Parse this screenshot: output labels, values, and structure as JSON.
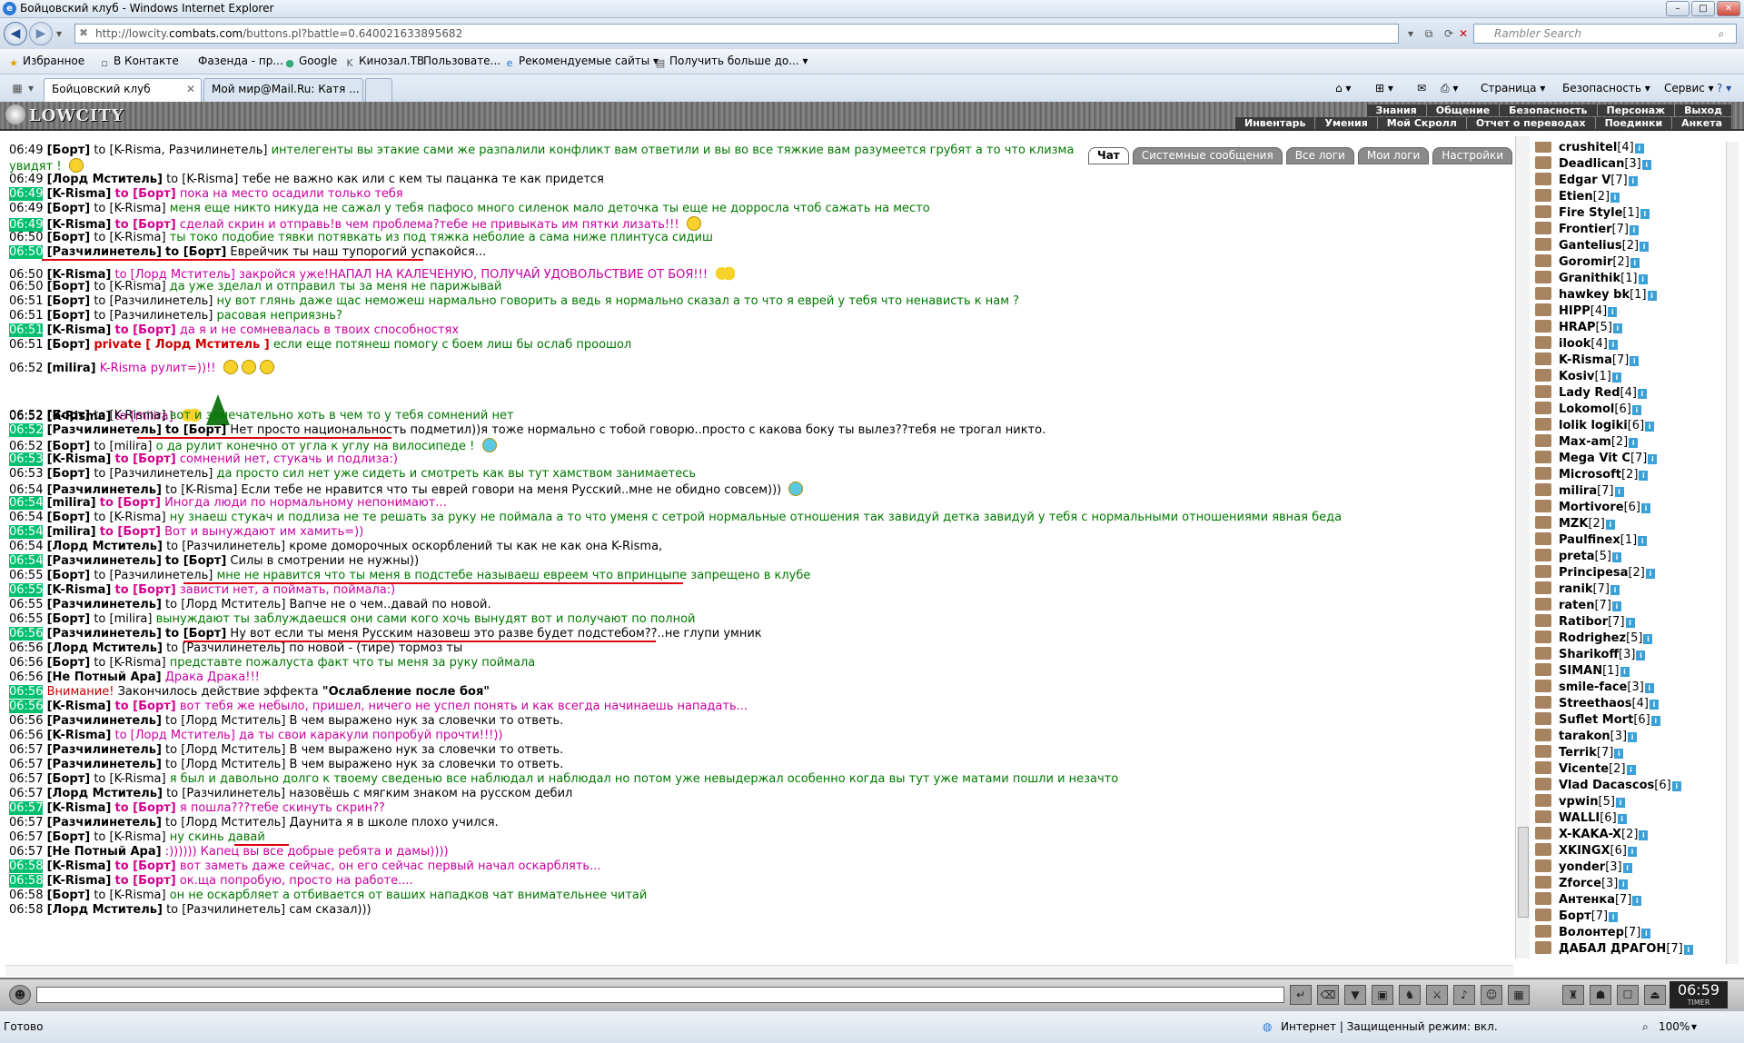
{
  "window": {
    "title": "Бойцовский клуб - Windows Internet Explorer",
    "min": "–",
    "max": "□",
    "close": "✕"
  },
  "address": {
    "prefix": "http://lowcity.",
    "domain": "combats.com",
    "suffix": "/buttons.pl?battle=0.640021633895682",
    "search_placeholder": "Rambler Search"
  },
  "favorites": {
    "label": "Избранное",
    "items": [
      "В Контакте",
      "Фазенда - пр...",
      "Google",
      "Кинозал.ТВ",
      "Пользовате...",
      "Рекомендуемые сайты",
      "Получить больше до..."
    ]
  },
  "tabs": [
    {
      "label": "Бойцовский клуб"
    },
    {
      "label": "Мой мир@Mail.Ru: Катя ..."
    }
  ],
  "commands": {
    "page": "Страница",
    "safety": "Безопасность",
    "service": "Сервис"
  },
  "game": {
    "logo": "LOWCITY",
    "menu1": [
      "Знания",
      "Общение",
      "Безопасность",
      "Персонаж",
      "Выход"
    ],
    "menu2": [
      "Инвентарь",
      "Умения",
      "Мой Скролл",
      "Отчет о переводах",
      "Поединки",
      "Анкета"
    ]
  },
  "chat_tabs": [
    "Чат",
    "Системные сообщения",
    "Все логи",
    "Мои логи",
    "Настройки"
  ],
  "chat": [
    {
      "t": "06:49",
      "hl": false,
      "nick": "[Борт]",
      "to": "to [K-Risma, Разчилинетель]",
      "tp": "n",
      "msg": "интелегенты вы этакие сами же разпалили конфликт вам ответили и вы во все тяжкие вам разумеется грубят а то что клизма",
      "mc": "g"
    },
    {
      "t": "",
      "hl": false,
      "nick": "",
      "to": "",
      "tp": "n",
      "msg": "увидят !",
      "mc": "g"
    },
    {
      "t": "06:49",
      "hl": false,
      "nick": "[Лорд Мститель]",
      "to": "to [K-Risma]",
      "tp": "n",
      "msg": "тебе не важно как или с кем ты пацанка те как придется",
      "mc": "k"
    },
    {
      "t": "06:49",
      "hl": true,
      "nick": "[K-Risma]",
      "to": "to [Борт]",
      "tp": "b",
      "msg": "пока на место осадили только тебя",
      "mc": "p"
    },
    {
      "t": "06:49",
      "hl": false,
      "nick": "[Борт]",
      "to": "to [K-Risma]",
      "tp": "n",
      "msg": "меня еще никто никуда не сажал у тебя пафосо много силенок мало деточка ты еще не дорросла чтоб сажать на место",
      "mc": "g"
    },
    {
      "t": "06:49",
      "hl": true,
      "nick": "[K-Risma]",
      "to": "to [Борт]",
      "tp": "b",
      "msg": "сделай скрин и отправь!в чем проблема?тебе не привыкать им пятки лизать!!!",
      "mc": "p"
    },
    {
      "t": "06:50",
      "hl": false,
      "nick": "[Борт]",
      "to": "to [K-Risma]",
      "tp": "n",
      "msg": "ты токо подобие тявки потявкать из под тяжка неболие а сама ниже плинтуса сидиш",
      "mc": "g"
    },
    {
      "t": "06:50",
      "hl": true,
      "nick": "[Разчилинетель]",
      "to": "to [Борт]",
      "tp": "nb",
      "msg": "Еврейчик ты наш тупорогий успакойся...",
      "mc": "k"
    },
    {
      "t": "06:50",
      "hl": false,
      "nick": "[K-Risma]",
      "to": "to [Лорд Мститель]",
      "tp": "p",
      "msg": "закройся уже!НАПАЛ НА КАЛЕЧЕНУЮ, ПОЛУЧАЙ УДОВОЛЬСТВИЕ ОТ БОЯ!!!",
      "mc": "p"
    },
    {
      "t": "06:50",
      "hl": false,
      "nick": "[Борт]",
      "to": "to [K-Risma]",
      "tp": "n",
      "msg": "да уже зделал и отправил ты за меня не парижывай",
      "mc": "g"
    },
    {
      "t": "06:51",
      "hl": false,
      "nick": "[Борт]",
      "to": "to [Разчилинетель]",
      "tp": "n",
      "msg": "ну вот глянь даже щас неможеш нармально говорить а ведь я нормально сказал а то что я еврей у тебя что ненависть к нам ?",
      "mc": "g"
    },
    {
      "t": "06:51",
      "hl": false,
      "nick": "[Борт]",
      "to": "to [Разчилинетель]",
      "tp": "n",
      "msg": "расовая неприязнь?",
      "mc": "g"
    },
    {
      "t": "06:51",
      "hl": true,
      "nick": "[K-Risma]",
      "to": "to [Борт]",
      "tp": "b",
      "msg": "да я и не сомневалась в твоих способностях",
      "mc": "p"
    },
    {
      "t": "06:51",
      "hl": false,
      "nick": "[Борт]",
      "to": "private [ Лорд Мститель ]",
      "tp": "r",
      "msg": "если еще потянеш помогу с боем лиш бы ослаб проошол",
      "mc": "g"
    },
    {
      "t": "06:52",
      "hl": false,
      "nick": "[milira]",
      "to": "",
      "tp": "n",
      "msg": "K-Risma рулит=))!!",
      "mc": "p"
    },
    {
      "t": "06:52",
      "hl": false,
      "nick": "[K-Risma]",
      "to": "to [milira]",
      "tp": "p",
      "msg": "",
      "mc": "p"
    },
    {
      "t": "06:52",
      "hl": false,
      "nick": "[Борт]",
      "to": "to [K-Risma]",
      "tp": "n",
      "msg": "вот и замечательно хоть в чем то у тебя сомнений нет",
      "mc": "g"
    },
    {
      "t": "06:52",
      "hl": true,
      "nick": "[Разчилинетель]",
      "to": "to [Борт]",
      "tp": "nb",
      "msg": "Нет просто национальность подметил))я тоже нормально с тобой говорю..просто с какова боку ты вылез??тебя не трогал никто.",
      "mc": "k"
    },
    {
      "t": "06:52",
      "hl": false,
      "nick": "[Борт]",
      "to": "to [milira]",
      "tp": "n",
      "msg": "о да рулит конечно от угла к углу на вилосипеде !",
      "mc": "g"
    },
    {
      "t": "06:53",
      "hl": true,
      "nick": "[K-Risma]",
      "to": "to [Борт]",
      "tp": "b",
      "msg": "сомнений нет, стукачь и подлиза:)",
      "mc": "p"
    },
    {
      "t": "06:53",
      "hl": false,
      "nick": "[Борт]",
      "to": "to [Разчилинетель]",
      "tp": "n",
      "msg": "да просто сил нет уже сидеть и смотреть как вы тут хамством занимаетесь",
      "mc": "g"
    },
    {
      "t": "06:54",
      "hl": false,
      "nick": "[Разчилинетель]",
      "to": "to [K-Risma]",
      "tp": "n",
      "msg": "Если тебе не нравится что ты еврей говори на меня Русский..мне не обидно совсем)))",
      "mc": "k"
    },
    {
      "t": "06:54",
      "hl": true,
      "nick": "[milira]",
      "to": "to [Борт]",
      "tp": "b",
      "msg": "Иногда люди по нормальному непонимают...",
      "mc": "p"
    },
    {
      "t": "06:54",
      "hl": false,
      "nick": "[Борт]",
      "to": "to [K-Risma]",
      "tp": "n",
      "msg": "ну знаеш стукач и подлиза не те решать за руку не поймала а то что уменя с сетрой нормальные отношения так завидуй детка завидуй у тебя с нормальными отношениями явная беда",
      "mc": "g"
    },
    {
      "t": "06:54",
      "hl": true,
      "nick": "[milira]",
      "to": "to [Борт]",
      "tp": "b",
      "msg": "Вот и вынуждают им хамить=))",
      "mc": "p"
    },
    {
      "t": "06:54",
      "hl": false,
      "nick": "[Лорд Мститель]",
      "to": "to [Разчилинетель]",
      "tp": "n",
      "msg": "кроме доморочных оскорблений ты как не как она K-Risma,",
      "mc": "k"
    },
    {
      "t": "06:54",
      "hl": true,
      "nick": "[Разчилинетель]",
      "to": "to [Борт]",
      "tp": "nb",
      "msg": "Силы в смотрении не нужны))",
      "mc": "k"
    },
    {
      "t": "06:55",
      "hl": false,
      "nick": "[Борт]",
      "to": "to [Разчилинетель]",
      "tp": "n",
      "msg": "мне не нравится что ты меня в подстебе называеш евреем что впринцыпе запрещено в клубе",
      "mc": "g"
    },
    {
      "t": "06:55",
      "hl": true,
      "nick": "[K-Risma]",
      "to": "to [Борт]",
      "tp": "b",
      "msg": "зависти нет, а поймать, поймала:)",
      "mc": "p"
    },
    {
      "t": "06:55",
      "hl": false,
      "nick": "[Разчилинетель]",
      "to": "to [Лорд Мститель]",
      "tp": "n",
      "msg": "Вапче не о чем..давай по новой.",
      "mc": "k"
    },
    {
      "t": "06:55",
      "hl": false,
      "nick": "[Борт]",
      "to": "to [milira]",
      "tp": "n",
      "msg": "вынуждают ты заблуждаешся они сами кого хочь вынудят вот и получают по полной",
      "mc": "g"
    },
    {
      "t": "06:56",
      "hl": true,
      "nick": "[Разчилинетель]",
      "to": "to [Борт]",
      "tp": "nb",
      "msg": "Ну вот если ты меня Русским назовеш это разве будет подстебом??..не глупи умник",
      "mc": "k"
    },
    {
      "t": "06:56",
      "hl": false,
      "nick": "[Лорд Мститель]",
      "to": "to [Разчилинетель]",
      "tp": "n",
      "msg": "по новой - (тире) тормоз ты",
      "mc": "k"
    },
    {
      "t": "06:56",
      "hl": false,
      "nick": "[Борт]",
      "to": "to [K-Risma]",
      "tp": "n",
      "msg": "представте пожалуста факт что ты меня за руку поймала",
      "mc": "g"
    },
    {
      "t": "06:56",
      "hl": false,
      "nick": "[Не Потный Ара]",
      "to": "",
      "tp": "n",
      "msg": "Драка Драка!!!",
      "mc": "p"
    },
    {
      "t": "06:56",
      "hl": true,
      "nick": "",
      "to": "",
      "tp": "w",
      "msg": "Закончилось действие эффекта",
      "mc": "k",
      "extra": "\"Ослабление после боя\"",
      "warn": "Внимание!"
    },
    {
      "t": "06:56",
      "hl": true,
      "nick": "[K-Risma]",
      "to": "to [Борт]",
      "tp": "b",
      "msg": "вот тебя же небыло, пришел, ничего не успел понять и как всегда начинаешь нападать...",
      "mc": "p"
    },
    {
      "t": "06:56",
      "hl": false,
      "nick": "[Разчилинетель]",
      "to": "to [Лорд Мститель]",
      "tp": "n",
      "msg": "В чем выражено нук за словечки то ответь.",
      "mc": "k"
    },
    {
      "t": "06:56",
      "hl": false,
      "nick": "[K-Risma]",
      "to": "to [Лорд Мститель]",
      "tp": "p",
      "msg": "да ты свои каракули попробуй прочти!!!))",
      "mc": "p"
    },
    {
      "t": "06:57",
      "hl": false,
      "nick": "[Разчилинетель]",
      "to": "to [Лорд Мститель]",
      "tp": "n",
      "msg": "В чем выражено нук за словечки то ответь.",
      "mc": "k"
    },
    {
      "t": "06:57",
      "hl": false,
      "nick": "[Разчилинетель]",
      "to": "to [Лорд Мститель]",
      "tp": "n",
      "msg": "В чем выражено нук за словечки то ответь.",
      "mc": "k"
    },
    {
      "t": "06:57",
      "hl": false,
      "nick": "[Борт]",
      "to": "to [K-Risma]",
      "tp": "n",
      "msg": "я был и давольно долго к твоему сведенью все наблюдал и наблюдал но потом уже невыдержал особенно когда вы тут уже матами пошли и незачто",
      "mc": "g"
    },
    {
      "t": "06:57",
      "hl": false,
      "nick": "[Лорд Мститель]",
      "to": "to [Разчилинетель]",
      "tp": "n",
      "msg": "назовёшь с мягким знаком на русском дебил",
      "mc": "k"
    },
    {
      "t": "06:57",
      "hl": true,
      "nick": "[K-Risma]",
      "to": "to [Борт]",
      "tp": "b",
      "msg": "я пошла???тебе скинуть скрин??",
      "mc": "p"
    },
    {
      "t": "06:57",
      "hl": false,
      "nick": "[Разчилинетель]",
      "to": "to [Лорд Мститель]",
      "tp": "n",
      "msg": "Даунита я в школе плохо учился.",
      "mc": "k"
    },
    {
      "t": "06:57",
      "hl": false,
      "nick": "[Борт]",
      "to": "to [K-Risma]",
      "tp": "n",
      "msg": "ну скинь давай",
      "mc": "g"
    },
    {
      "t": "06:57",
      "hl": false,
      "nick": "[Не Потный Ара]",
      "to": "",
      "tp": "n",
      "msg": ":)))))) Капец вы все добрые ребята и дамы))))",
      "mc": "p"
    },
    {
      "t": "06:58",
      "hl": true,
      "nick": "[K-Risma]",
      "to": "to [Борт]",
      "tp": "b",
      "msg": "вот заметь даже сейчас, он его сейчас первый начал оскарблять...",
      "mc": "p"
    },
    {
      "t": "06:58",
      "hl": true,
      "nick": "[K-Risma]",
      "to": "to [Борт]",
      "tp": "b",
      "msg": "ок.ща попробую, просто на работе....",
      "mc": "p"
    },
    {
      "t": "06:58",
      "hl": false,
      "nick": "[Борт]",
      "to": "to [K-Risma]",
      "tp": "n",
      "msg": "он не оскарбляет а отбивается от ваших нападков чат внимательнее читай",
      "mc": "g"
    },
    {
      "t": "06:58",
      "hl": false,
      "nick": "[Лорд Мститель]",
      "to": "to [Разчилинетель]",
      "tp": "n",
      "msg": "сам сказал)))",
      "mc": "k"
    }
  ],
  "users": [
    {
      "name": "crushitel",
      "lvl": "[4]"
    },
    {
      "name": "Deadlican",
      "lvl": "[3]"
    },
    {
      "name": "Edgar V",
      "lvl": "[7]"
    },
    {
      "name": "Etien",
      "lvl": "[2]"
    },
    {
      "name": "Fire Style",
      "lvl": "[1]"
    },
    {
      "name": "Frontier",
      "lvl": "[7]"
    },
    {
      "name": "Gantelius",
      "lvl": "[2]"
    },
    {
      "name": "Goromir",
      "lvl": "[2]"
    },
    {
      "name": "Granithik",
      "lvl": "[1]"
    },
    {
      "name": "hawkey bk",
      "lvl": "[1]"
    },
    {
      "name": "HIPP",
      "lvl": "[4]"
    },
    {
      "name": "HRAP",
      "lvl": "[5]"
    },
    {
      "name": "ilook",
      "lvl": "[4]"
    },
    {
      "name": "K-Risma",
      "lvl": "[7]"
    },
    {
      "name": "Kosiv",
      "lvl": "[1]"
    },
    {
      "name": "Lady Red",
      "lvl": "[4]"
    },
    {
      "name": "Lokomol",
      "lvl": "[6]"
    },
    {
      "name": "lolik logiki",
      "lvl": "[6]"
    },
    {
      "name": "Max-am",
      "lvl": "[2]"
    },
    {
      "name": "Mega Vit C",
      "lvl": "[7]"
    },
    {
      "name": "Microsoft",
      "lvl": "[2]"
    },
    {
      "name": "milira",
      "lvl": "[7]"
    },
    {
      "name": "Mortivore",
      "lvl": "[6]"
    },
    {
      "name": "MZK",
      "lvl": "[2]"
    },
    {
      "name": "Paulfinex",
      "lvl": "[1]"
    },
    {
      "name": "preta",
      "lvl": "[5]"
    },
    {
      "name": "Principesa",
      "lvl": "[2]"
    },
    {
      "name": "ranik",
      "lvl": "[7]"
    },
    {
      "name": "raten",
      "lvl": "[7]"
    },
    {
      "name": "Ratibor",
      "lvl": "[7]"
    },
    {
      "name": "Rodrighez",
      "lvl": "[5]"
    },
    {
      "name": "Sharikoff",
      "lvl": "[3]"
    },
    {
      "name": "SIMAN",
      "lvl": "[1]"
    },
    {
      "name": "smile-face",
      "lvl": "[3]"
    },
    {
      "name": "Streethaos",
      "lvl": "[4]"
    },
    {
      "name": "Suflet Mort",
      "lvl": "[6]"
    },
    {
      "name": "tarakon",
      "lvl": "[3]"
    },
    {
      "name": "Terrik",
      "lvl": "[7]"
    },
    {
      "name": "Vicente",
      "lvl": "[2]"
    },
    {
      "name": "Vlad Dacascos",
      "lvl": "[6]"
    },
    {
      "name": "vpwin",
      "lvl": "[5]"
    },
    {
      "name": "WALLI",
      "lvl": "[6]"
    },
    {
      "name": "X-KAKA-X",
      "lvl": "[2]"
    },
    {
      "name": "XKINGX",
      "lvl": "[6]"
    },
    {
      "name": "yonder",
      "lvl": "[3]"
    },
    {
      "name": "Zforce",
      "lvl": "[3]"
    },
    {
      "name": "Антенка",
      "lvl": "[7]"
    },
    {
      "name": "Борт",
      "lvl": "[7]"
    },
    {
      "name": "Волонтер",
      "lvl": "[7]"
    },
    {
      "name": "ДАБАЛ ДРАГОН",
      "lvl": "[7]"
    }
  ],
  "clock": {
    "time": "06:59",
    "sub": "TIMER"
  },
  "status": {
    "ready": "Готово",
    "zone": "Интернет | Защищенный режим: вкл.",
    "zoom": "100%"
  },
  "icons": {
    "back": "arrow-left-icon",
    "forward": "arrow-right-icon",
    "refresh": "refresh-icon",
    "stop": "stop-icon",
    "search": "magnifier-icon",
    "home": "home-icon"
  }
}
